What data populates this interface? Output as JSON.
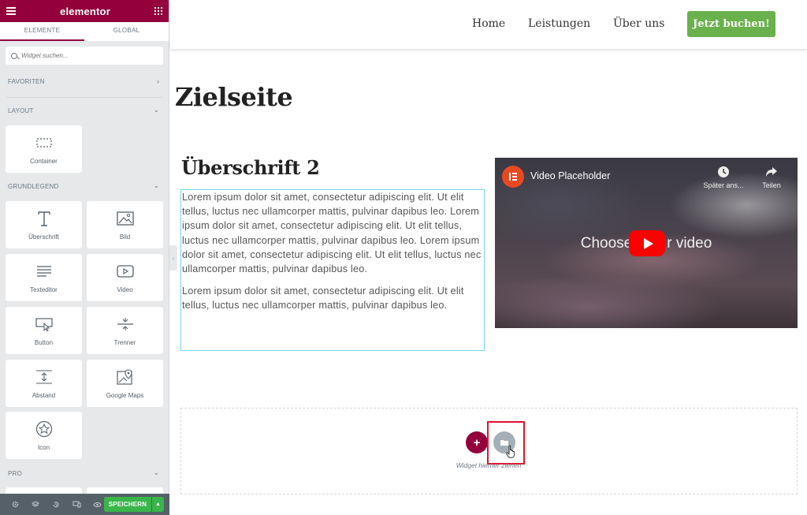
{
  "panel": {
    "logo": "elementor",
    "tabs": [
      {
        "label": "ELEMENTE"
      },
      {
        "label": "GLOBAL"
      }
    ],
    "search": {
      "placeholder": "Widget suchen..."
    },
    "sections": {
      "favoriten": "FAVORITEN",
      "layout": "LAYOUT",
      "grundlegend": "GRUNDLEGEND",
      "pro": "PRO"
    },
    "widgets": {
      "container": "Container",
      "ueberschrift": "Überschrift",
      "bild": "Bild",
      "texteditor": "Texteditor",
      "video": "Video",
      "button": "Button",
      "trenner": "Trenner",
      "abstand": "Abstand",
      "google_maps": "Google Maps",
      "icon": "Icon"
    },
    "footer": {
      "save_label": "SPEICHERN",
      "icons": [
        "settings-icon",
        "layers-icon",
        "history-icon",
        "responsive-icon",
        "preview-eye-icon"
      ]
    }
  },
  "site": {
    "nav": {
      "home": "Home",
      "leistungen": "Leistungen",
      "ueber_uns": "Über uns",
      "cta": "Jetzt buchen!"
    },
    "page_title": "Zielseite",
    "heading2": "Überschrift 2",
    "paragraphs": [
      "Lorem ipsum dolor sit amet, consectetur adipiscing elit. Ut elit tellus, luctus nec ullamcorper mattis, pulvinar dapibus leo. Lorem ipsum dolor sit amet, consectetur adipiscing elit. Ut elit tellus, luctus nec ullamcorper mattis, pulvinar dapibus leo. Lorem ipsum dolor sit amet, consectetur adipiscing elit. Ut elit tellus, luctus nec ullamcorper mattis, pulvinar dapibus leo.",
      "Lorem ipsum dolor sit amet, consectetur adipiscing elit. Ut elit tellus, luctus nec ullamcorper mattis, pulvinar dapibus leo."
    ],
    "video": {
      "title": "Video Placeholder",
      "watch_later": "Später ans...",
      "share": "Teilen",
      "choose_left": "Choose",
      "choose_right": "r video"
    },
    "drop_zone": {
      "hint": "Widget hierher ziehen"
    }
  },
  "colors": {
    "brand": "#93003c",
    "save_green": "#39b54a",
    "cta_green": "#6ab04c",
    "highlight_red": "#e3132b",
    "selection_blue": "#71d7f7"
  }
}
